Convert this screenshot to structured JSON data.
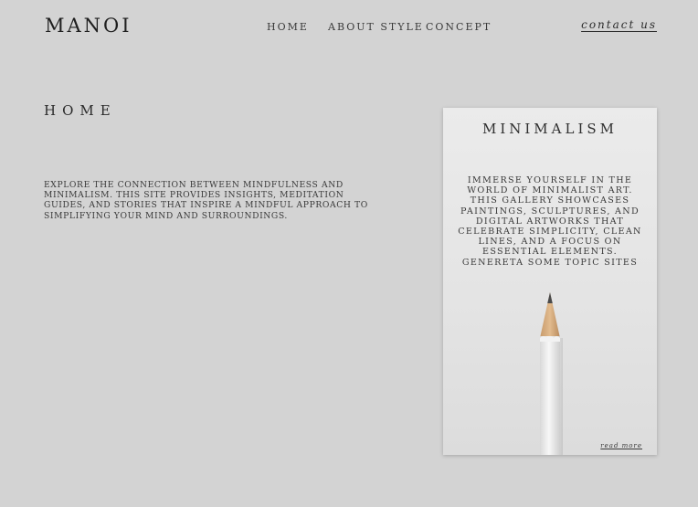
{
  "header": {
    "logo": "MANOI",
    "nav": {
      "home": "HOME",
      "about": "ABOUT STYLE",
      "concept": "CONCEPT"
    },
    "contact": "contact us"
  },
  "main": {
    "title": "HOME",
    "intro": "Explore the connection between mindfulness and minimalism. This site provides insights, meditation guides, and stories that inspire a mindful approach to simplifying your mind and surroundings."
  },
  "card": {
    "title": "MINIMALISM",
    "text": "Immerse yourself in the world of minimalist art. This gallery showcases paintings, sculptures, and digital artworks that celebrate simplicity, clean lines, and a focus on essential elements. Genereta some topic sites",
    "read_more": "read more"
  },
  "colors": {
    "background": "#d3d3d3",
    "card_background": "#e6e6e6",
    "text": "#2b2b2b"
  }
}
